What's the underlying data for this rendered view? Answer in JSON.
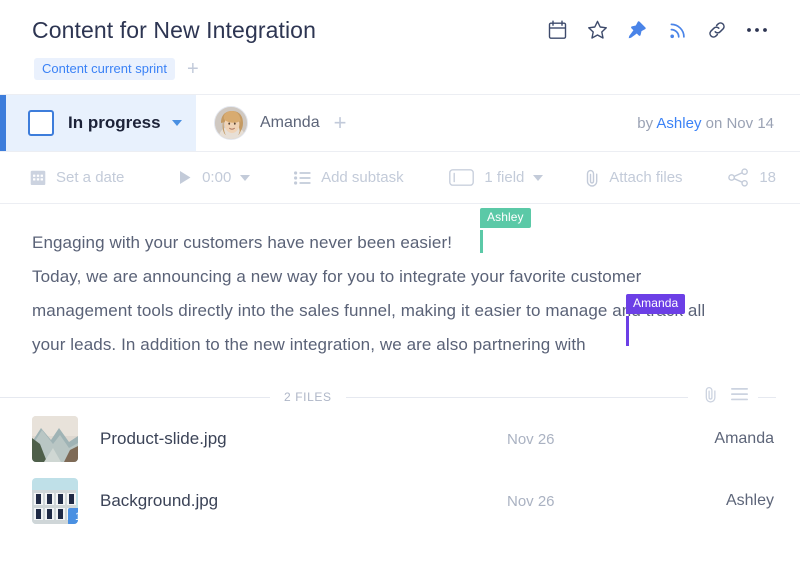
{
  "header": {
    "title": "Content for New Integration",
    "icons": [
      {
        "name": "calendar-icon",
        "label": "Calendar"
      },
      {
        "name": "star-icon",
        "label": "Favorite"
      },
      {
        "name": "pin-icon",
        "label": "Pin"
      },
      {
        "name": "feed-icon",
        "label": "Follow"
      },
      {
        "name": "link-icon",
        "label": "Copy link"
      },
      {
        "name": "more-icon",
        "label": "More"
      }
    ],
    "tag": "Content current sprint",
    "tag_add": "+"
  },
  "status": {
    "label": "In progress",
    "checkbox_checked": false,
    "assignee": "Amanda",
    "assignee_add": "+",
    "meta_prefix": "by ",
    "meta_author": "Ashley",
    "meta_suffix": " on Nov 14"
  },
  "toolbar": {
    "set_date": "Set a date",
    "timer": "0:00",
    "add_subtask": "Add subtask",
    "fields": "1 field",
    "attach_files": "Attach files",
    "share_count": "18"
  },
  "body": {
    "line1": "Engaging with your customers have never been easier!",
    "line2": "Today, we are announcing a new way for you to integrate your favorite customer",
    "line3": "management tools directly into the sales funnel, making it easier to manage and track all",
    "line4": "your leads. In addition to the new integration, we are also partnering with",
    "cursors": [
      {
        "name": "Ashley",
        "color": "#5bc9a7"
      },
      {
        "name": "Amanda",
        "color": "#6c3fe6"
      }
    ]
  },
  "files": {
    "divider_label": "2 FILES",
    "items": [
      {
        "name": "Product-slide.jpg",
        "date": "Nov 26",
        "owner": "Amanda",
        "comments": ""
      },
      {
        "name": "Background.jpg",
        "date": "Nov 26",
        "owner": "Ashley",
        "comments": "1"
      }
    ]
  },
  "colors": {
    "accent_blue": "#3d7ddb",
    "link_blue": "#3b82f6",
    "status_bg": "#e8f1fd",
    "cursor_teal": "#5bc9a7",
    "cursor_purple": "#6c3fe6",
    "badge_blue": "#4a90e2"
  }
}
